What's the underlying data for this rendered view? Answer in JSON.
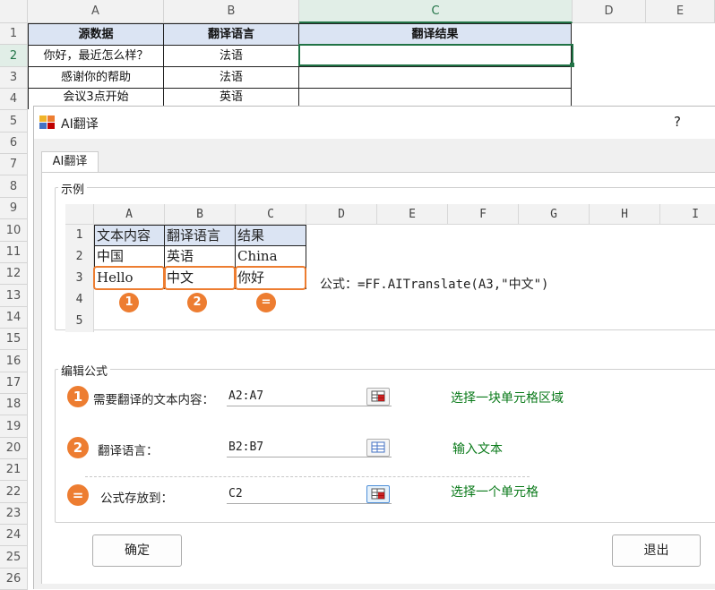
{
  "spreadsheet": {
    "columns": [
      "A",
      "B",
      "C",
      "D",
      "E"
    ],
    "rows": [
      "1",
      "2",
      "3",
      "4",
      "5",
      "6",
      "7",
      "8",
      "9",
      "10",
      "11",
      "12",
      "13",
      "14",
      "15",
      "16",
      "17",
      "18",
      "19",
      "20",
      "21",
      "22",
      "23",
      "24",
      "25",
      "26"
    ],
    "table": {
      "headers": [
        "源数据",
        "翻译语言",
        "翻译结果"
      ],
      "data": [
        [
          "你好，最近怎么样？",
          "法语",
          ""
        ],
        [
          "感谢你的帮助",
          "法语",
          ""
        ],
        [
          "会议3点开始",
          "英语",
          ""
        ]
      ]
    },
    "active_cell": "C2"
  },
  "dialog": {
    "title": "AI翻译",
    "help": "?",
    "tab": "AI翻译",
    "example_group": "示例",
    "example": {
      "columns": [
        "A",
        "B",
        "C",
        "D",
        "E",
        "F",
        "G",
        "H",
        "I"
      ],
      "rows": [
        "1",
        "2",
        "3",
        "4",
        "5"
      ],
      "cells": [
        [
          "文本内容",
          "翻译语言",
          "结果"
        ],
        [
          "中国",
          "英语",
          "China"
        ],
        [
          "Hello",
          "中文",
          "你好"
        ]
      ],
      "badges": [
        "1",
        "2",
        "="
      ],
      "formula": "公式：=FF.AITranslate(A3,\"中文\")"
    },
    "edit_group": "编辑公式",
    "fields": [
      {
        "badge": "1",
        "label": "需要翻译的文本内容：",
        "value": "A2:A7",
        "hint": "选择一块单元格区域"
      },
      {
        "badge": "2",
        "label": "翻译语言：",
        "value": "B2:B7",
        "hint": "输入文本"
      },
      {
        "badge": "=",
        "label": "公式存放到：",
        "value": "C2",
        "hint": "选择一个单元格"
      }
    ],
    "ok": "确定",
    "exit": "退出"
  },
  "colors": {
    "accent": "#ed7d31",
    "hint": "#0a7a1a",
    "header_fill": "#dbe4f3",
    "excel_green": "#217346"
  }
}
